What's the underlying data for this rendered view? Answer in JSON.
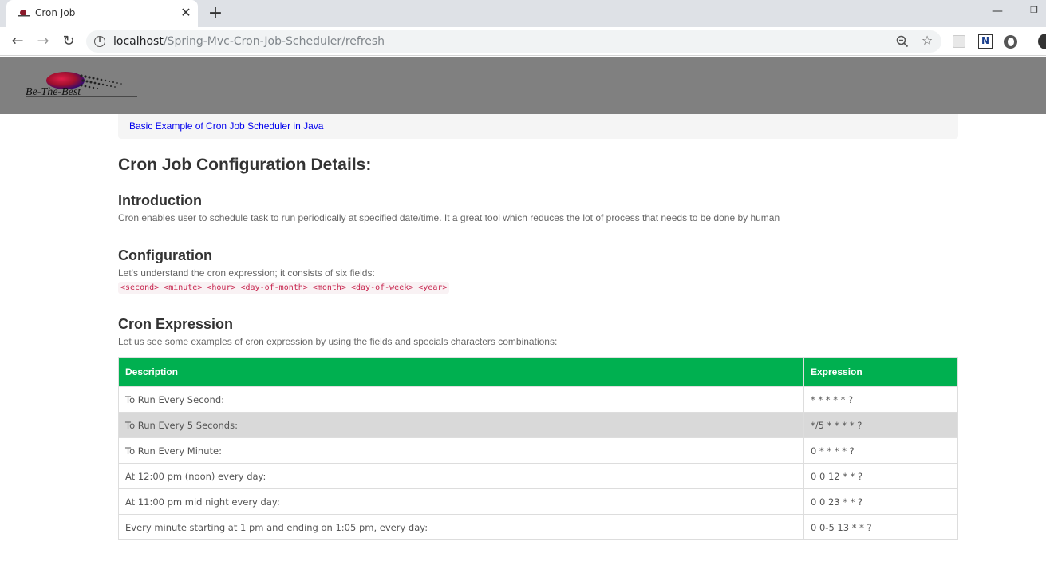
{
  "browser": {
    "tab_title": "Cron Job",
    "tab_close": "✕",
    "new_tab": "+",
    "url_host": "localhost",
    "url_path": "/Spring-Mvc-Cron-Job-Scheduler/refresh",
    "minimize": "—",
    "restore": "❐"
  },
  "header": {
    "logo_text": "Be-The-Best"
  },
  "breadcrumb": {
    "link": "Basic Example of Cron Job Scheduler in Java"
  },
  "page_title": "Cron Job Configuration Details:",
  "introduction": {
    "heading": "Introduction",
    "text": "Cron enables user to schedule task to run periodically at specified date/time. It a great tool which reduces the lot of process that needs to be done by human"
  },
  "configuration": {
    "heading": "Configuration",
    "text": "Let's understand the cron expression; it consists of six fields:",
    "code": "<second> <minute> <hour> <day-of-month> <month> <day-of-week> <year>"
  },
  "cron_expression": {
    "heading": "Cron Expression",
    "text": "Let us see some examples of cron expression by using the fields and specials characters combinations:"
  },
  "table": {
    "headers": [
      "Description",
      "Expression"
    ],
    "rows": [
      {
        "description": "To Run Every Second:",
        "expression": "* * * * * ?"
      },
      {
        "description": "To Run Every 5 Seconds:",
        "expression": "*/5 * * * * ?"
      },
      {
        "description": "To Run Every Minute:",
        "expression": "0 * * * * ?"
      },
      {
        "description": "At 12:00 pm (noon) every day:",
        "expression": "0 0 12 * * ?"
      },
      {
        "description": "At 11:00 pm mid night every day:",
        "expression": "0 0 23 * * ?"
      },
      {
        "description": "Every minute starting at 1 pm and ending on 1:05 pm, every day:",
        "expression": "0 0-5 13 * * ?"
      }
    ]
  },
  "colors": {
    "header_bg": "#808080",
    "table_header": "#00b050",
    "link": "#0000ee",
    "code_text": "#c7254e"
  },
  "icons": [
    "back-arrow-icon",
    "forward-arrow-icon",
    "reload-icon",
    "info-icon",
    "zoom-icon",
    "star-icon"
  ]
}
